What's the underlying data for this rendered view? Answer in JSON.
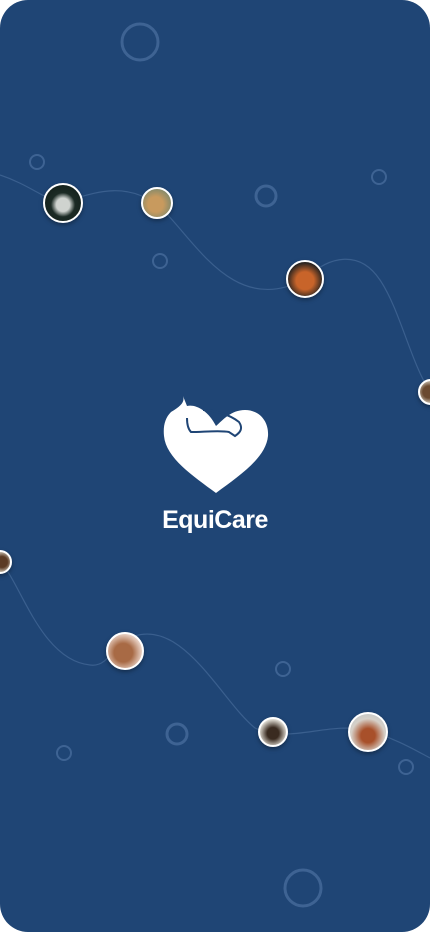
{
  "app": {
    "name": "EquiCare"
  },
  "colors": {
    "background": "#1f4575",
    "accent": "#ffffff"
  },
  "icons": [
    "horse-heart-logo-icon"
  ]
}
